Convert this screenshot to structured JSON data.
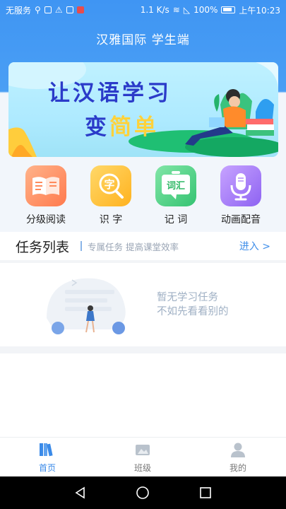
{
  "status_bar": {
    "carrier": "无服务",
    "speed": "1.1 K/s",
    "battery": "100%",
    "time": "上午10:23"
  },
  "header": {
    "title": "汉雅国际 学生端"
  },
  "banner": {
    "line1": "让汉语学习",
    "line2_a": "变",
    "line2_b": "简单"
  },
  "quick_entries": [
    {
      "label": "分级阅读",
      "icon": "book-icon",
      "color": "#ff7a4d"
    },
    {
      "label": "识 字",
      "icon": "character-magnifier-icon",
      "color": "#ffb21f",
      "glyph": "字"
    },
    {
      "label": "记 词",
      "icon": "word-chat-icon",
      "color": "#35c372",
      "glyph": "词汇"
    },
    {
      "label": "动画配音",
      "icon": "microphone-icon",
      "color": "#8e63f2"
    }
  ],
  "tasks": {
    "title": "任务列表",
    "subtitle": "专属任务 提高课堂效率",
    "enter": "进入 >",
    "empty_line1": "暂无学习任务",
    "empty_line2": "不如先看看别的"
  },
  "tabbar": [
    {
      "label": "首页",
      "icon": "home-books-icon",
      "active": true
    },
    {
      "label": "班级",
      "icon": "class-icon",
      "active": false
    },
    {
      "label": "我的",
      "icon": "profile-icon",
      "active": false
    }
  ],
  "colors": {
    "primary": "#3f95f3",
    "accent_text": "#3f8ee9",
    "banner_text": "#2b3bc9"
  }
}
